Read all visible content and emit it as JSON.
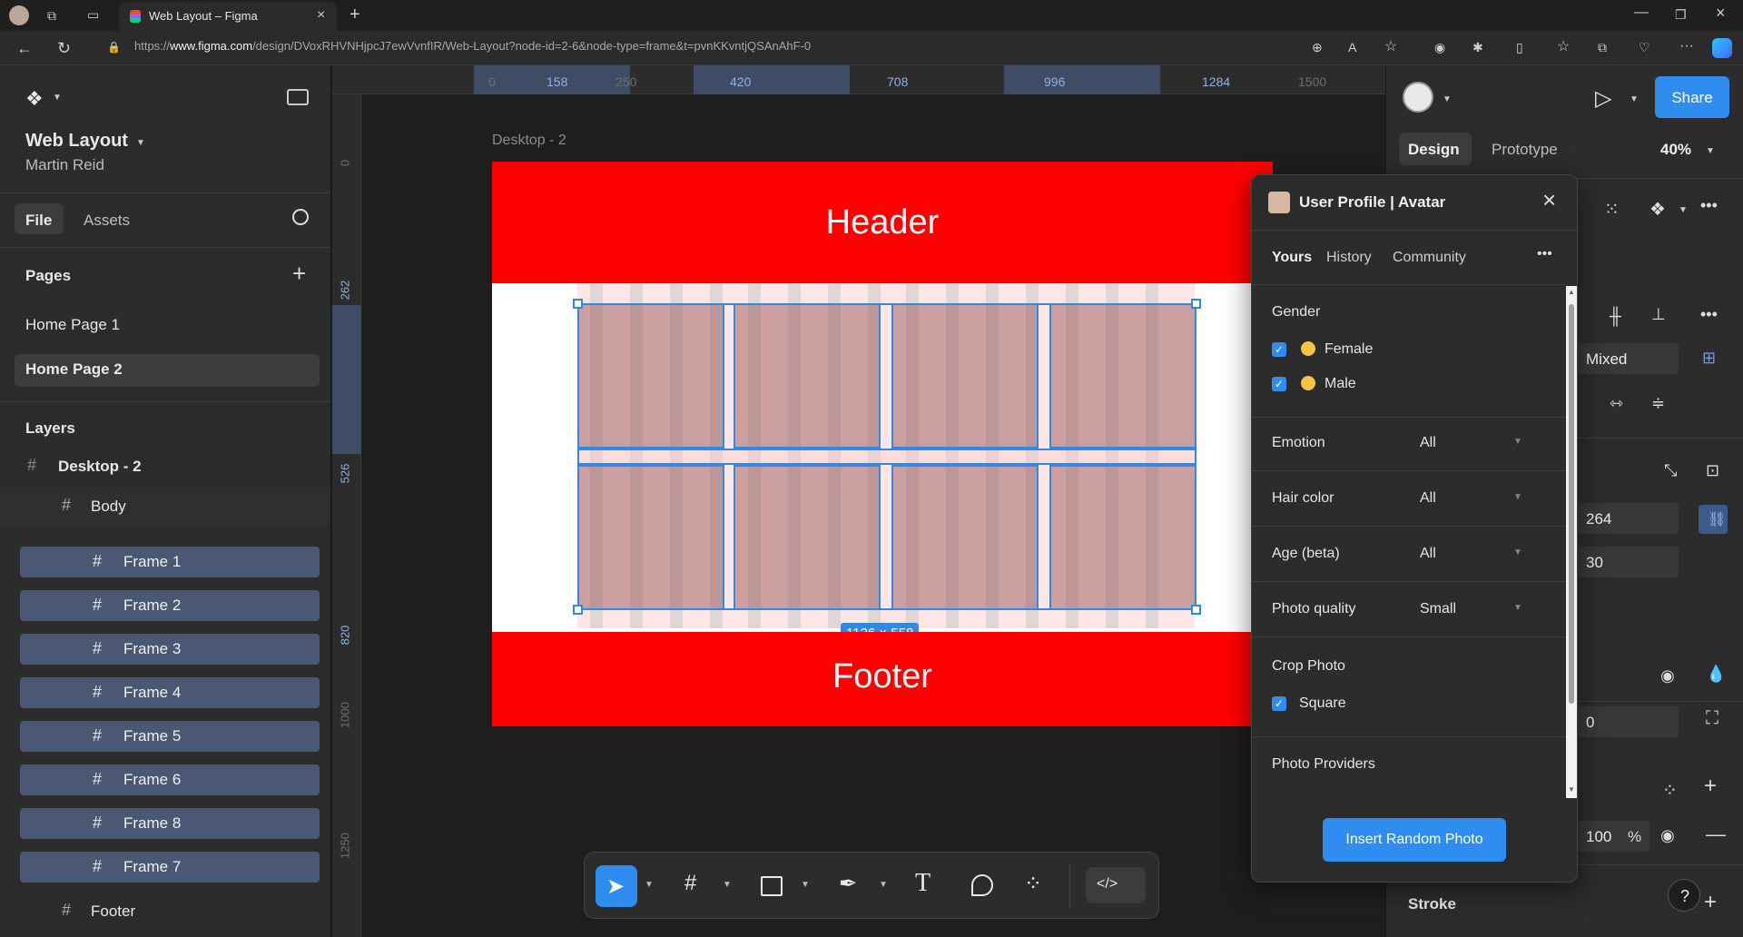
{
  "browser": {
    "tab_title": "Web Layout – Figma",
    "url_prefix": "https://",
    "url_host": "www.figma.com",
    "url_path": "/design/DVoxRHVNHjpcJ7ewVvnfIR/Web-Layout?node-id=2-6&node-type=frame&t=pvnKKvntjQSAnAhF-0"
  },
  "file": {
    "name": "Web Layout",
    "owner": "Martin Reid",
    "tabs": [
      "File",
      "Assets"
    ]
  },
  "pages": {
    "heading": "Pages",
    "items": [
      "Home Page 1",
      "Home Page 2"
    ],
    "selected": "Home Page 2"
  },
  "layers": {
    "heading": "Layers",
    "root": "Desktop - 2",
    "body": "Body",
    "frames": [
      "Frame 1",
      "Frame 2",
      "Frame 3",
      "Frame 4",
      "Frame 5",
      "Frame 6",
      "Frame 8",
      "Frame 7"
    ],
    "footer": "Footer"
  },
  "rulers": {
    "top": [
      "0",
      "158",
      "250",
      "420",
      "708",
      "996",
      "1284",
      "1500"
    ],
    "left": [
      "0",
      "262",
      "526",
      "820",
      "1000",
      "1250"
    ]
  },
  "canvas": {
    "frame_label": "Desktop - 2",
    "header_text": "Header",
    "footer_text": "Footer",
    "size_badge": "1126 × 558",
    "colors": {
      "header": "#ff0000",
      "selection": "#2e8ae6"
    }
  },
  "right_panel": {
    "tabs": [
      "Design",
      "Prototype"
    ],
    "zoom": "40%",
    "share_label": "Share",
    "mixed": "Mixed",
    "width": "264",
    "height": "30",
    "value_zero": "0",
    "opacity": "100",
    "percent": "%",
    "stroke": "Stroke",
    "help": "?"
  },
  "plugin": {
    "title": "User Profile | Avatar",
    "tabs": [
      "Yours",
      "History",
      "Community"
    ],
    "gender_label": "Gender",
    "gender_options": [
      "Female",
      "Male"
    ],
    "filters": [
      {
        "label": "Emotion",
        "value": "All"
      },
      {
        "label": "Hair color",
        "value": "All"
      },
      {
        "label": "Age (beta)",
        "value": "All"
      },
      {
        "label": "Photo quality",
        "value": "Small"
      }
    ],
    "crop_label": "Crop Photo",
    "crop_option": "Square",
    "providers_label": "Photo Providers",
    "insert_button": "Insert Random Photo"
  }
}
